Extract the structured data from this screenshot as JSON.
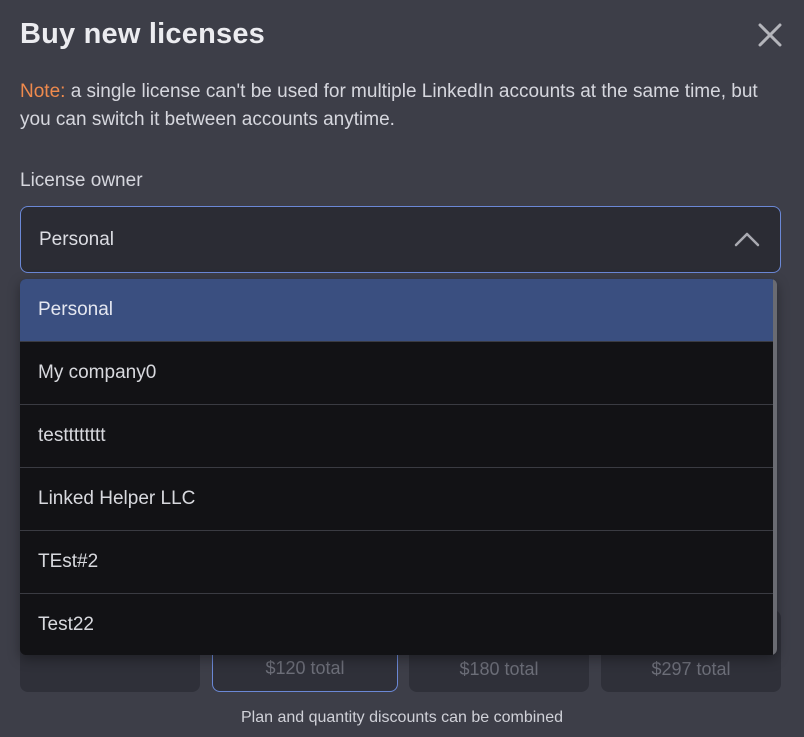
{
  "dialog": {
    "title": "Buy new licenses",
    "note_label": "Note:",
    "note_text": " a single license can't be used for multiple LinkedIn accounts at the same time, but you can switch it between accounts anytime."
  },
  "license_owner": {
    "label": "License owner",
    "selected": "Personal",
    "options": [
      "Personal",
      "My company0",
      "testttttttt",
      "Linked Helper LLC",
      "TEst#2",
      "Test22"
    ]
  },
  "plans": [
    {
      "total": ""
    },
    {
      "total": "$120 total"
    },
    {
      "total": "$180 total"
    },
    {
      "total": "$297 total"
    }
  ],
  "footer": {
    "note": "Plan and quantity discounts can be combined"
  },
  "icons": {
    "close": "close-icon",
    "chevron": "chevron-up-icon"
  },
  "colors": {
    "background": "#3d3e48",
    "accent": "#6b88d6",
    "note_label": "#ef8a4d",
    "active_option": "#3a4f80",
    "dropdown_bg": "#121215"
  }
}
